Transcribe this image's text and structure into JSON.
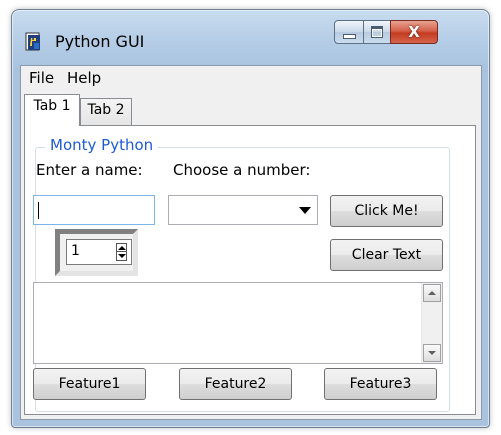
{
  "window": {
    "title": "Python GUI",
    "close_glyph": "X",
    "accent_color": "#1e5bd1"
  },
  "menu": {
    "items": [
      {
        "label": "File"
      },
      {
        "label": "Help"
      }
    ]
  },
  "tabs": [
    {
      "label": "Tab 1",
      "selected": true
    },
    {
      "label": "Tab 2",
      "selected": false
    }
  ],
  "group": {
    "title": "Monty Python"
  },
  "form": {
    "name_label": "Enter a name:",
    "number_label": "Choose a number:",
    "name_value": "",
    "number_value": "",
    "spin_value": "1"
  },
  "buttons": {
    "click_me": "Click Me!",
    "clear_text": "Clear Text",
    "feature1": "Feature1",
    "feature2": "Feature2",
    "feature3": "Feature3"
  },
  "scrolled_text": {
    "content": ""
  },
  "icons": {
    "app": "python-app-icon",
    "minimize": "minimize-icon",
    "maximize": "maximize-icon",
    "close": "close-icon"
  }
}
